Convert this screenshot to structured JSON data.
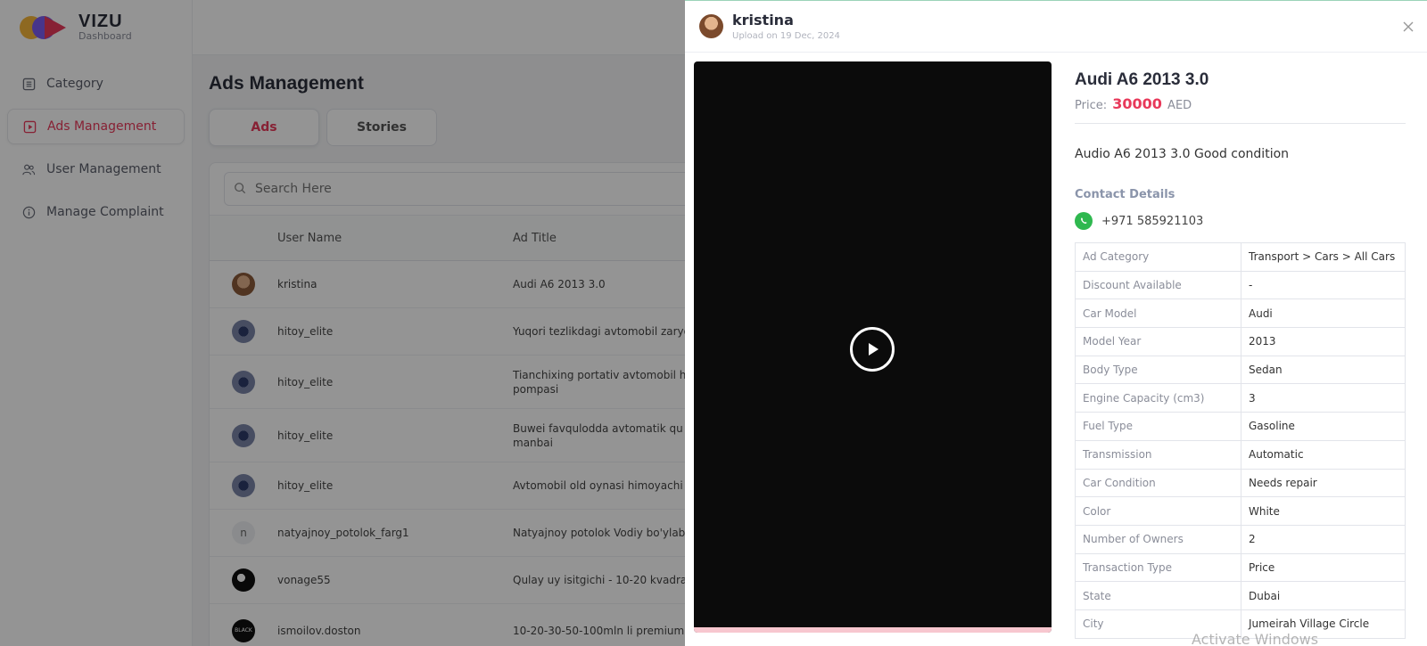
{
  "brand": {
    "name": "VIZU",
    "sub": "Dashboard"
  },
  "sidebar": {
    "items": [
      {
        "label": "Category",
        "icon": "list-icon"
      },
      {
        "label": "Ads Management",
        "icon": "play-square-icon",
        "active": true
      },
      {
        "label": "User Management",
        "icon": "users-icon"
      },
      {
        "label": "Manage Complaint",
        "icon": "info-icon"
      }
    ]
  },
  "main": {
    "title": "Ads Management",
    "tabs": [
      {
        "label": "Ads",
        "active": true
      },
      {
        "label": "Stories"
      }
    ],
    "search": {
      "placeholder": "Search Here"
    },
    "columns": [
      "User Name",
      "Ad Title"
    ],
    "rows": [
      {
        "user": "kristina",
        "title": "Audi A6 2013 3.0",
        "avatar": "k"
      },
      {
        "user": "hitoy_elite",
        "title": "Yuqori tezlikdagi avtomobil zaryo",
        "avatar": "h"
      },
      {
        "user": "hitoy_elite",
        "title": "Tianchixing portativ avtomobil h pompasi",
        "avatar": "h"
      },
      {
        "user": "hitoy_elite",
        "title": "Buwei favqulodda avtomatik qu manbai",
        "avatar": "h"
      },
      {
        "user": "hitoy_elite",
        "title": "Avtomobil old oynasi himoyachi",
        "avatar": "h"
      },
      {
        "user": "natyajnoy_potolok_farg1",
        "title": "Natyajnoy potolok Vodiy bo'ylab",
        "avatar": "n",
        "initial": "n"
      },
      {
        "user": "vonage55",
        "title": "Qulay uy isitgichi - 10-20 kvadra",
        "avatar": "v"
      },
      {
        "user": "ismoilov.doston",
        "title": "10-20-30-50-100mln li premium",
        "avatar": "i",
        "initial": "BLACK"
      }
    ]
  },
  "modal": {
    "user": "kristina",
    "upload_date": "Upload on 19 Dec, 2024",
    "ad_title": "Audi A6 2013 3.0",
    "price_label": "Price:",
    "price": "30000",
    "currency": "AED",
    "description": "Audio A6 2013 3.0 Good condition",
    "contact_title": "Contact Details",
    "phone": "+971 585921103",
    "video_progress": 0.0,
    "details": [
      {
        "k": "Ad Category",
        "v": "Transport > Cars > All Cars"
      },
      {
        "k": "Discount Available",
        "v": "-"
      },
      {
        "k": "Car Model",
        "v": "Audi"
      },
      {
        "k": "Model Year",
        "v": "2013"
      },
      {
        "k": "Body Type",
        "v": "Sedan"
      },
      {
        "k": "Engine Capacity (cm3)",
        "v": "3"
      },
      {
        "k": "Fuel Type",
        "v": "Gasoline"
      },
      {
        "k": "Transmission",
        "v": "Automatic"
      },
      {
        "k": "Car Condition",
        "v": "Needs repair"
      },
      {
        "k": "Color",
        "v": "White"
      },
      {
        "k": "Number of Owners",
        "v": "2"
      },
      {
        "k": "Transaction Type",
        "v": "Price"
      },
      {
        "k": "State",
        "v": "Dubai"
      },
      {
        "k": "City",
        "v": "Jumeirah Village Circle"
      }
    ]
  },
  "watermark": "Activate Windows",
  "colors": {
    "accent": "#e8395a",
    "whatsapp": "#2fb84f",
    "overlay": "#000000"
  }
}
